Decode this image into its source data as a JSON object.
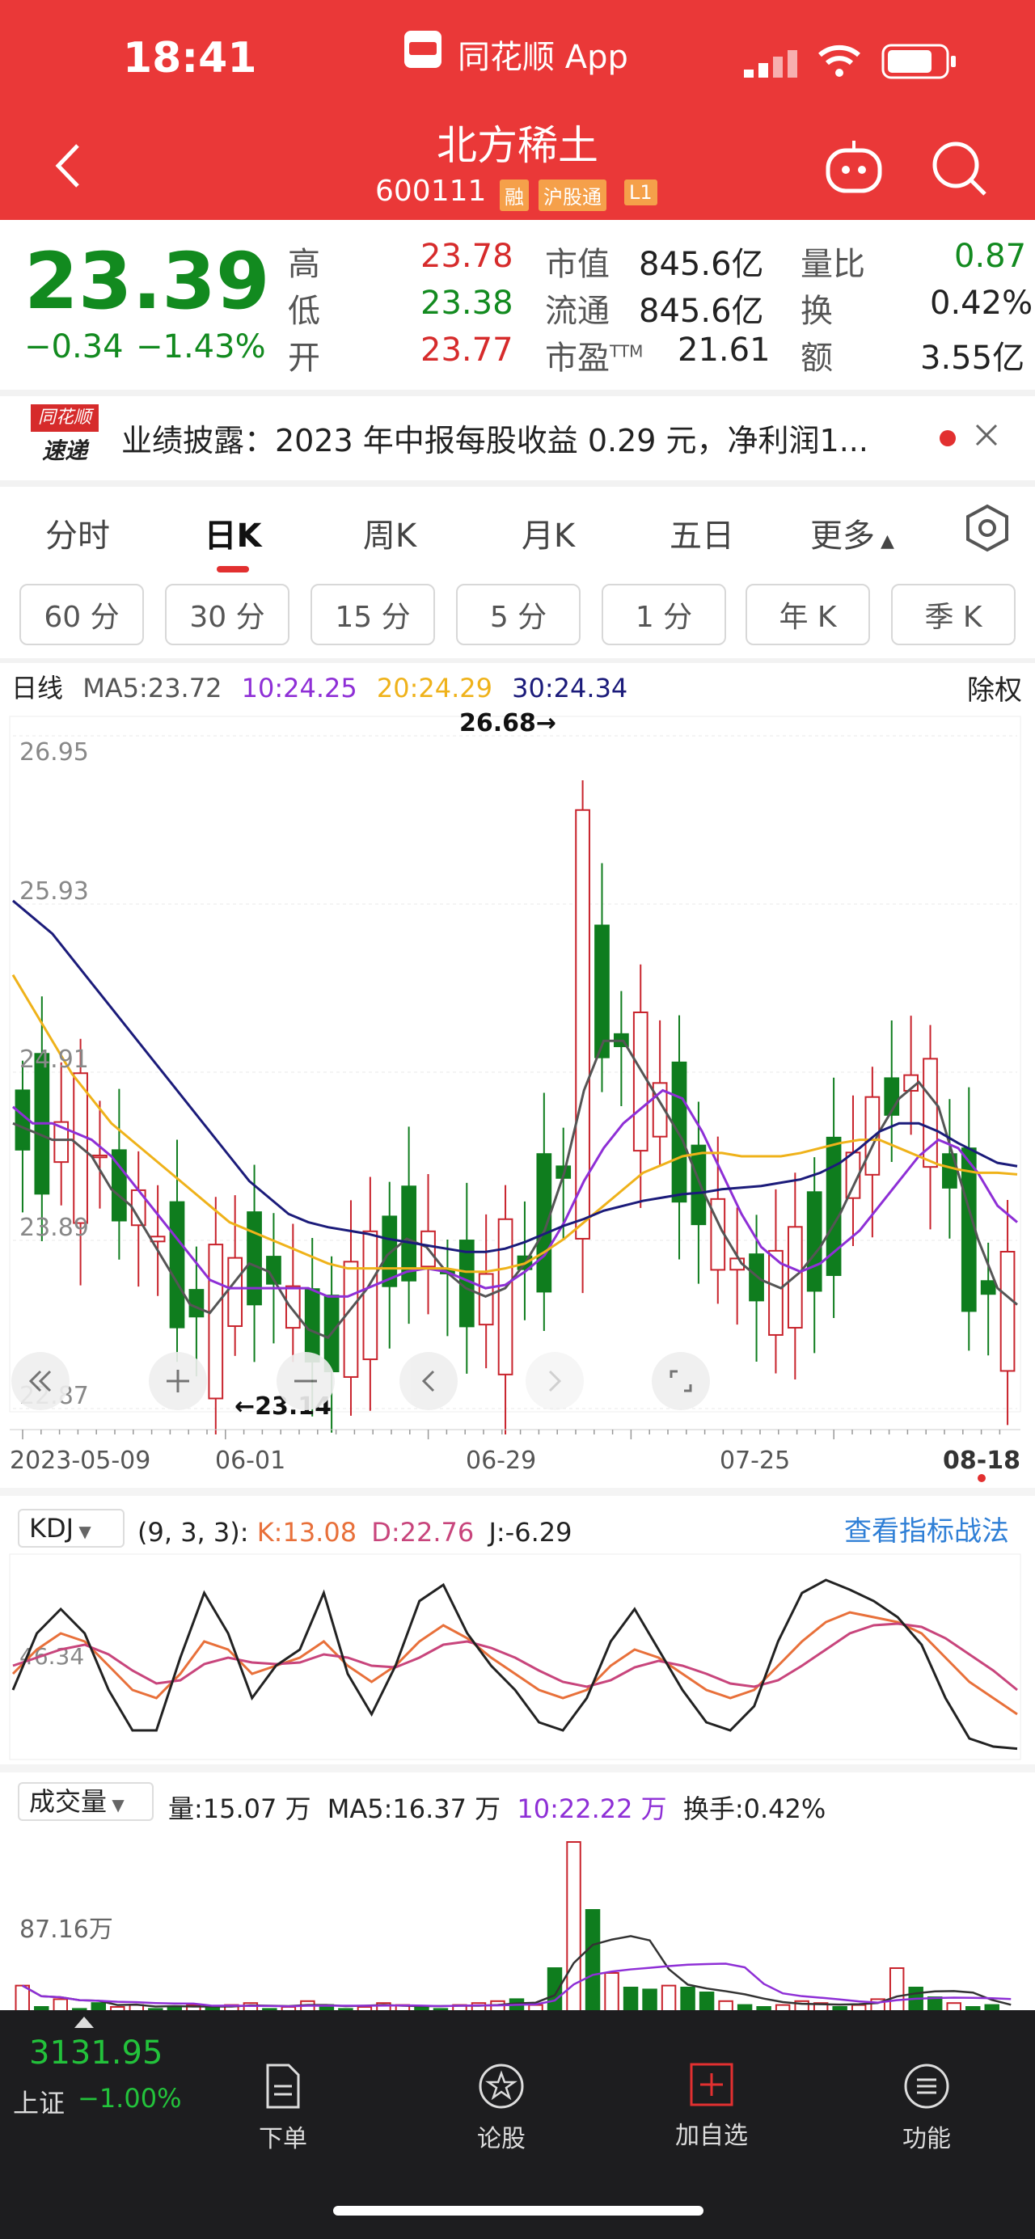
{
  "status_bar": {
    "time": "18:41",
    "app_label": "同花顺 App"
  },
  "header": {
    "title": "北方稀土",
    "code": "600111",
    "tags": [
      "融",
      "沪股通",
      "L1"
    ]
  },
  "quote": {
    "price": "23.39",
    "change": "−0.34",
    "change_pct": "−1.43%",
    "high_label": "高",
    "high": "23.78",
    "low_label": "低",
    "low": "23.38",
    "open_label": "开",
    "open": "23.77",
    "mktcap_label": "市值",
    "mktcap": "845.6亿",
    "float_label": "流通",
    "float": "845.6亿",
    "pe_label": "市盈",
    "pe_sup": "TTM",
    "pe": "21.61",
    "volratio_label": "量比",
    "volratio": "0.87",
    "turnover_label": "换",
    "turnover": "0.42%",
    "amount_label": "额",
    "amount": "3.55亿"
  },
  "news": {
    "badge_top": "同花顺",
    "badge_bottom": "速递",
    "text": "业绩披露：2023 年中报每股收益 0.29 元，净利润1..."
  },
  "tabs": [
    "分时",
    "日K",
    "周K",
    "月K",
    "五日",
    "更多"
  ],
  "active_tab": "日K",
  "periods": [
    "60 分",
    "30 分",
    "15 分",
    "5 分",
    "1 分",
    "年 K",
    "季 K"
  ],
  "ma_legend": {
    "line": "日线",
    "ma5": "MA5:23.72",
    "ma10": "10:24.25",
    "ma20": "20:24.29",
    "ma30": "30:24.34",
    "adjust": "除权"
  },
  "chart_data": [
    {
      "type": "candlestick",
      "title": "日线",
      "y_ticks": [
        "26.95",
        "25.93",
        "24.91",
        "23.89",
        "22.87"
      ],
      "ylim": [
        22.87,
        26.95
      ],
      "x_ticks": [
        "2023-05-09",
        "06-01",
        "06-29",
        "07-25",
        "08-18"
      ],
      "max_marker": "26.68→",
      "min_marker": "←23.14",
      "series": [
        {
          "name": "MA5",
          "color": "#555555",
          "values": [
            24.6,
            24.55,
            24.5,
            24.5,
            24.4,
            24.2,
            24.1,
            23.9,
            23.7,
            23.5,
            23.45,
            23.6,
            23.75,
            23.7,
            23.5,
            23.35,
            23.3,
            23.45,
            23.6,
            23.8,
            23.9,
            23.85,
            23.7,
            23.6,
            23.55,
            23.6,
            23.75,
            23.95,
            24.3,
            24.8,
            25.1,
            25.1,
            24.9,
            24.7,
            24.5,
            24.2,
            23.95,
            23.75,
            23.65,
            23.6,
            23.7,
            23.85,
            24.05,
            24.3,
            24.55,
            24.75,
            24.85,
            24.7,
            24.3,
            23.9,
            23.6,
            23.5
          ]
        },
        {
          "name": "MA10",
          "color": "#8e2fd6",
          "values": [
            24.7,
            24.6,
            24.6,
            24.55,
            24.5,
            24.4,
            24.25,
            24.1,
            23.95,
            23.8,
            23.65,
            23.6,
            23.6,
            23.6,
            23.6,
            23.6,
            23.55,
            23.55,
            23.6,
            23.65,
            23.7,
            23.72,
            23.7,
            23.65,
            23.6,
            23.62,
            23.7,
            23.8,
            24.0,
            24.25,
            24.45,
            24.6,
            24.7,
            24.8,
            24.75,
            24.55,
            24.3,
            24.05,
            23.85,
            23.75,
            23.7,
            23.75,
            23.85,
            23.95,
            24.1,
            24.25,
            24.4,
            24.5,
            24.45,
            24.3,
            24.1,
            24.0
          ]
        },
        {
          "name": "MA20",
          "color": "#efb21a",
          "values": [
            25.5,
            25.3,
            25.1,
            24.9,
            24.75,
            24.6,
            24.5,
            24.4,
            24.3,
            24.2,
            24.1,
            24.0,
            23.95,
            23.9,
            23.85,
            23.8,
            23.75,
            23.72,
            23.72,
            23.72,
            23.72,
            23.72,
            23.72,
            23.7,
            23.7,
            23.72,
            23.75,
            23.82,
            23.9,
            24.0,
            24.1,
            24.2,
            24.3,
            24.35,
            24.4,
            24.42,
            24.42,
            24.4,
            24.4,
            24.4,
            24.42,
            24.45,
            24.48,
            24.5,
            24.5,
            24.45,
            24.4,
            24.35,
            24.32,
            24.3,
            24.3,
            24.29
          ]
        },
        {
          "name": "MA30",
          "color": "#1b1b7a",
          "values": [
            25.95,
            25.85,
            25.75,
            25.6,
            25.45,
            25.3,
            25.15,
            25.0,
            24.85,
            24.7,
            24.55,
            24.4,
            24.25,
            24.15,
            24.05,
            24.0,
            23.97,
            23.95,
            23.93,
            23.9,
            23.88,
            23.86,
            23.84,
            23.82,
            23.82,
            23.84,
            23.88,
            23.93,
            23.98,
            24.02,
            24.07,
            24.1,
            24.13,
            24.15,
            24.17,
            24.18,
            24.2,
            24.21,
            24.22,
            24.24,
            24.26,
            24.3,
            24.36,
            24.45,
            24.55,
            24.6,
            24.6,
            24.55,
            24.48,
            24.42,
            24.36,
            24.34
          ]
        }
      ]
    },
    {
      "type": "line",
      "title": "KDJ",
      "params": "(9, 3, 3):",
      "k_label": "K:13.08",
      "d_label": "D:22.76",
      "j_label": "J:-6.29",
      "ref_tick": "46.34",
      "ylim": [
        -10,
        110
      ],
      "series": [
        {
          "name": "K",
          "color": "#e8703a",
          "values": [
            40,
            55,
            65,
            60,
            45,
            30,
            25,
            40,
            60,
            55,
            40,
            45,
            50,
            60,
            45,
            35,
            45,
            60,
            70,
            62,
            50,
            40,
            30,
            25,
            30,
            45,
            55,
            50,
            40,
            30,
            25,
            30,
            45,
            60,
            72,
            78,
            75,
            72,
            65,
            50,
            35,
            25,
            15
          ]
        },
        {
          "name": "D",
          "color": "#c8457c",
          "values": [
            45,
            50,
            55,
            58,
            52,
            42,
            34,
            36,
            46,
            50,
            47,
            46,
            47,
            52,
            50,
            45,
            44,
            50,
            58,
            60,
            56,
            50,
            42,
            35,
            32,
            36,
            44,
            48,
            45,
            40,
            34,
            32,
            36,
            45,
            55,
            65,
            70,
            71,
            69,
            62,
            52,
            42,
            30
          ]
        },
        {
          "name": "J",
          "color": "#222222",
          "values": [
            30,
            65,
            80,
            65,
            30,
            5,
            5,
            50,
            90,
            65,
            25,
            45,
            55,
            90,
            40,
            15,
            45,
            85,
            95,
            65,
            45,
            30,
            10,
            5,
            25,
            60,
            80,
            55,
            30,
            10,
            5,
            20,
            60,
            90,
            98,
            92,
            85,
            75,
            58,
            25,
            0,
            -5,
            -6.29
          ]
        }
      ]
    },
    {
      "type": "bar",
      "title": "成交量",
      "vol_label": "量:15.07 万",
      "ma5_label": "MA5:16.37 万",
      "ma10_label": "10:22.22 万",
      "turnover_label": "换手:0.42%",
      "ref_tick": "87.16万",
      "ylim": [
        0,
        200
      ],
      "values": [
        42,
        20,
        28,
        18,
        24,
        20,
        22,
        18,
        20,
        22,
        20,
        22,
        24,
        18,
        20,
        26,
        22,
        18,
        20,
        24,
        22,
        20,
        18,
        22,
        24,
        26,
        28,
        22,
        60,
        190,
        120,
        55,
        40,
        38,
        42,
        40,
        35,
        26,
        22,
        20,
        22,
        26,
        24,
        20,
        22,
        28,
        60,
        40,
        30,
        24,
        20,
        22,
        15.07
      ],
      "up": [
        1,
        0,
        1,
        0,
        0,
        1,
        1,
        0,
        0,
        1,
        0,
        1,
        1,
        0,
        1,
        1,
        0,
        0,
        1,
        1,
        1,
        0,
        0,
        1,
        1,
        1,
        0,
        1,
        0,
        1,
        0,
        1,
        0,
        0,
        1,
        0,
        0,
        1,
        0,
        0,
        1,
        1,
        1,
        0,
        1,
        1,
        1,
        0,
        0,
        1,
        0,
        0,
        0
      ]
    }
  ],
  "kdj_link": "查看指标战法",
  "bottom_bar": {
    "index_value": "3131.95",
    "index_name": "上证",
    "index_change": "−1.00%",
    "items": [
      "下单",
      "论股",
      "加自选",
      "功能"
    ]
  }
}
